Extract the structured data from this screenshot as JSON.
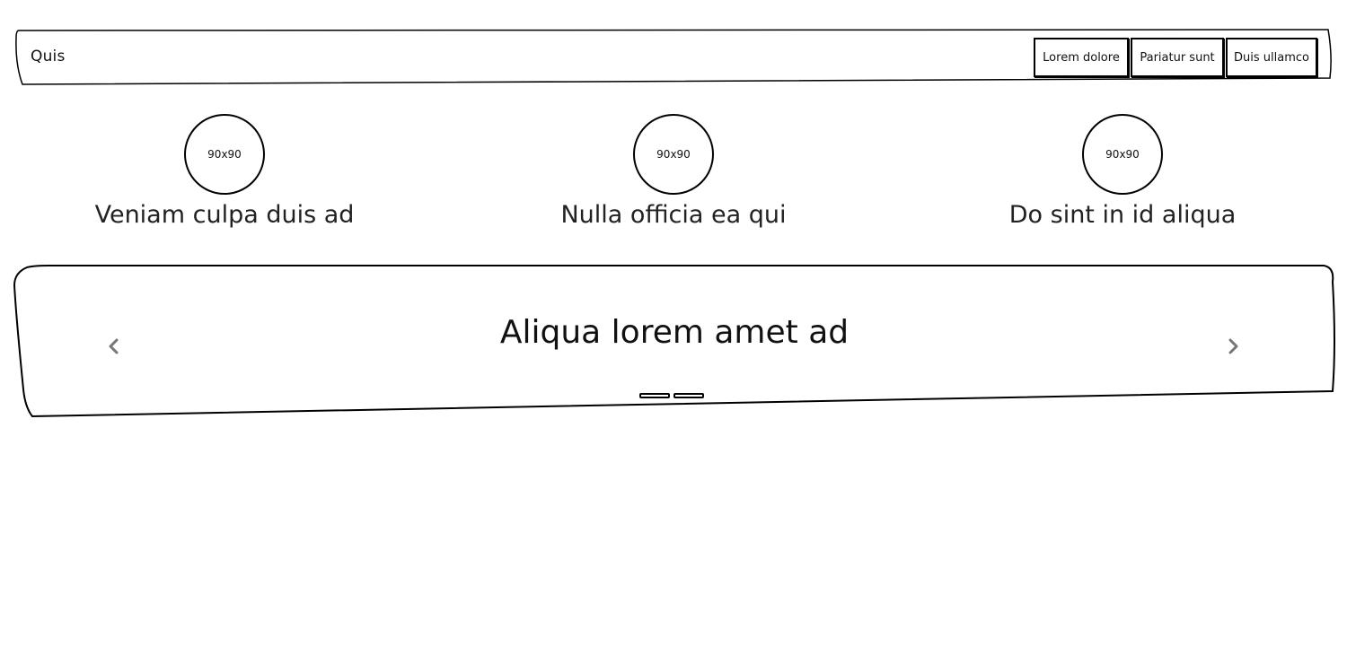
{
  "navbar": {
    "brand": "Quis",
    "buttons": [
      {
        "label": "Lorem dolore"
      },
      {
        "label": "Pariatur sunt"
      },
      {
        "label": "Duis ullamco"
      }
    ]
  },
  "features": [
    {
      "image_label": "90x90",
      "title": "Veniam culpa duis ad"
    },
    {
      "image_label": "90x90",
      "title": "Nulla officia ea qui"
    },
    {
      "image_label": "90x90",
      "title": "Do sint in id aliqua"
    }
  ],
  "carousel": {
    "caption": "Aliqua lorem amet ad",
    "prev_icon": "chevron-left-icon",
    "next_icon": "chevron-right-icon",
    "slide_count": 2
  },
  "colors": {
    "stroke": "#000000",
    "arrow": "#777777",
    "background": "#ffffff"
  }
}
